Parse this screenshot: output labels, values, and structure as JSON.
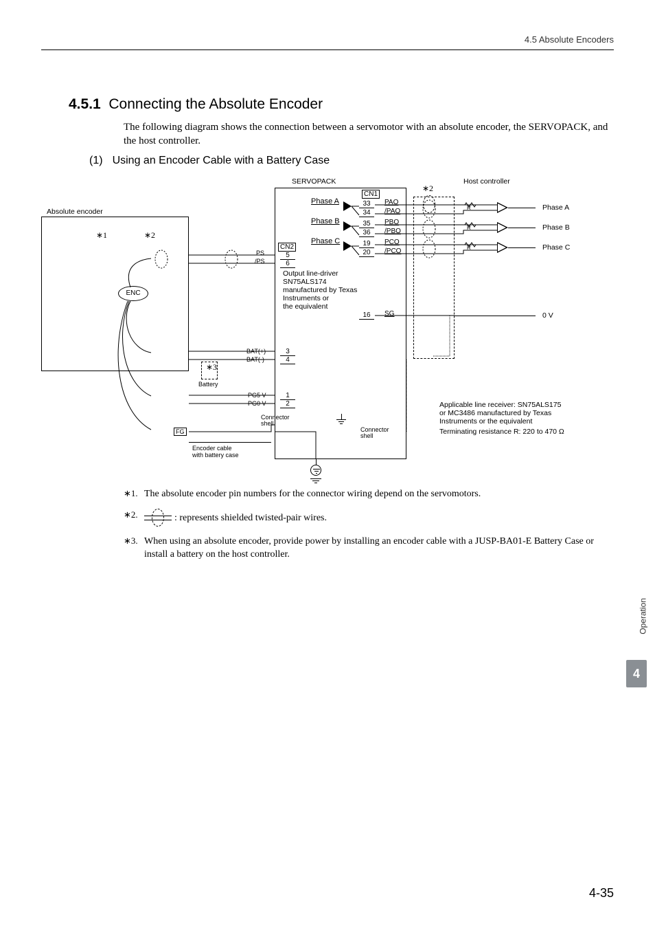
{
  "header": {
    "breadcrumb": "4.5  Absolute Encoders"
  },
  "section": {
    "number": "4.5.1",
    "title": "Connecting the Absolute Encoder",
    "intro": "The following diagram shows the connection between a servomotor with an absolute encoder, the SERVOPACK, and the host controller."
  },
  "subsection": {
    "number": "(1)",
    "title": "Using an Encoder Cable with a Battery Case"
  },
  "diagram": {
    "servopack": "SERVOPACK",
    "host": "Host controller",
    "abs_encoder": "Absolute encoder",
    "enc": "ENC",
    "ast1": "∗1",
    "ast2": "∗2",
    "ast3": "∗3",
    "cn1": "CN1",
    "cn2": "CN2",
    "ps": "PS",
    "nps": "/PS",
    "batp": "BAT(+)",
    "batn": "BAT(-)",
    "battery": "Battery",
    "pg5v": "PG5 V",
    "pg0v": "PG0 V",
    "fg": "FG",
    "conn_shell": [
      "Connector",
      "shell"
    ],
    "enc_cable": [
      "Encoder cable",
      "with battery case"
    ],
    "cn2_pins": [
      "5",
      "6",
      "3",
      "4",
      "1",
      "2"
    ],
    "phases": [
      {
        "int": "Phase A",
        "pin1": "33",
        "pin2": "34",
        "sig1": "PAO",
        "sig2": "/PAO",
        "ext": "Phase A"
      },
      {
        "int": "Phase B",
        "pin1": "35",
        "pin2": "36",
        "sig1": "PBO",
        "sig2": "/PBO",
        "ext": "Phase B"
      },
      {
        "int": "Phase C",
        "pin1": "19",
        "pin2": "20",
        "sig1": "PCO",
        "sig2": "/PCO",
        "ext": "Phase C"
      }
    ],
    "driver_note": [
      "Output line-driver",
      "SN75ALS174",
      "manufactured by Texas",
      "Instruments or",
      "the equivalent"
    ],
    "sg_pin": "16",
    "sg": "SG",
    "zero_v": "0 V",
    "r_label": "R",
    "receiver_note": [
      "Applicable line receiver: SN75ALS175",
      "or MC3486 manufactured by Texas",
      "Instruments or the equivalent"
    ],
    "term_note": "Terminating resistance R: 220 to 470 Ω"
  },
  "footnotes": [
    {
      "num": "∗1.",
      "text": "The absolute encoder pin numbers for the connector wiring depend on the servomotors."
    },
    {
      "num": "∗2.",
      "text": ": represents shielded twisted-pair wires."
    },
    {
      "num": "∗3.",
      "text": "When using an absolute encoder, provide power by installing an encoder cable with a JUSP-BA01-E Battery Case or install a battery on the host controller."
    }
  ],
  "sidebar": {
    "label": "Operation",
    "chapter": "4"
  },
  "footer": {
    "page": "4-35"
  }
}
